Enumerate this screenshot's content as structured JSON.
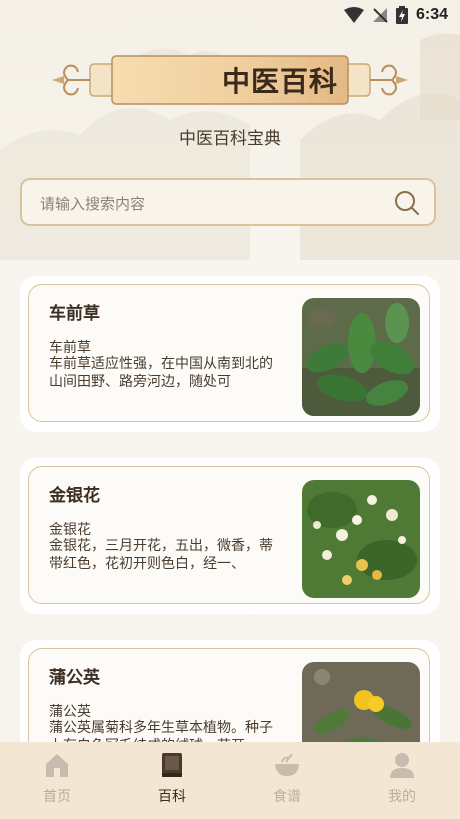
{
  "status": {
    "time": "6:34"
  },
  "header": {
    "title": "中医百科",
    "subtitle": "中医百科宝典"
  },
  "search": {
    "placeholder": "请输入搜索内容"
  },
  "cards": [
    {
      "title": "车前草",
      "name": "车前草",
      "desc": "车前草适应性强，在中国从南到北的山间田野、路旁河边，随处可"
    },
    {
      "title": "金银花",
      "name": "金银花",
      "desc": "金银花，三月开花，五出，微香，蒂带红色，花初开则色白，经一、"
    },
    {
      "title": "蒲公英",
      "name": "蒲公英",
      "desc": "蒲公英属菊科多年生草本植物。种子上有白色冠毛结成的绒球，花开"
    }
  ],
  "nav": [
    {
      "label": "首页",
      "icon": "home-icon"
    },
    {
      "label": "百科",
      "icon": "book-icon",
      "active": true
    },
    {
      "label": "食谱",
      "icon": "bowl-icon"
    },
    {
      "label": "我的",
      "icon": "user-icon"
    }
  ],
  "colors": {
    "accent": "#d9c39b",
    "banner": "#e9c99a",
    "nav_bg": "#f3e7d3"
  }
}
